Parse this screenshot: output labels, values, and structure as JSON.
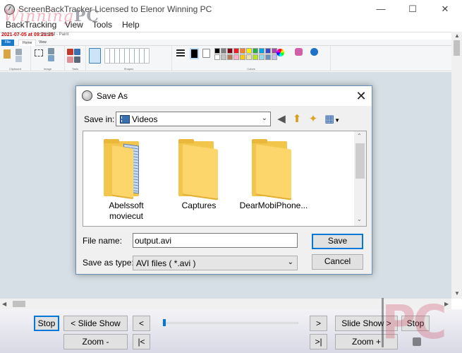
{
  "window": {
    "title": "ScreenBackTracker Licensed to Elenor Winning PC",
    "watermark_text": "Winning",
    "watermark_bold": "PC",
    "minimize": "—",
    "maximize": "☐",
    "close": "✕"
  },
  "menu": {
    "items": [
      "BackTracking",
      "View",
      "Tools",
      "Help"
    ]
  },
  "capture": {
    "timestamp": "2021-07-05 at 09:21:25",
    "paint_title": "Untitled - Paint",
    "tabs": [
      "File",
      "Home",
      "View"
    ],
    "ribbon_groups": [
      "Clipboard",
      "Image",
      "Tools",
      "Shapes",
      "Colors"
    ],
    "ribbon_labels": {
      "paste": "Paste",
      "cut": "Cut",
      "copy": "Copy",
      "select": "Select",
      "crop": "Crop",
      "resize": "Resize",
      "rotate": "Rotate",
      "brushes": "Brushes",
      "outline": "Outline",
      "fill": "Fill",
      "size": "Size",
      "color1": "Color 1",
      "color2": "Color 2",
      "edit_colors": "Edit colors",
      "edit_paint3d": "Edit with Paint 3D",
      "product_alert": "Product alert"
    },
    "palette": [
      "#000000",
      "#7f7f7f",
      "#880015",
      "#ed1c24",
      "#ff7f27",
      "#fff200",
      "#22b14c",
      "#00a2e8",
      "#3f48cc",
      "#a349a4",
      "#ffffff",
      "#c3c3c3",
      "#b97a57",
      "#ffaec9",
      "#ffc90e",
      "#efe4b0",
      "#b5e61d",
      "#99d9ea",
      "#7092be",
      "#c8bfe7"
    ]
  },
  "dialog": {
    "title": "Save As",
    "close": "✕",
    "save_in_label": "Save in:",
    "save_in_value": "Videos",
    "back_icon": "◀",
    "up_icon": "⬆",
    "new_folder_icon": "✦",
    "view_icon": "▦",
    "folders": [
      {
        "name": "Abelssoft moviecut",
        "line1": "Abelssoft",
        "line2": "moviecut"
      },
      {
        "name": "Captures",
        "line1": "Captures",
        "line2": ""
      },
      {
        "name": "DearMobiPhone...",
        "line1": "DearMobiPhone...",
        "line2": ""
      }
    ],
    "file_name_label": "File name:",
    "file_name_value": "output.avi",
    "save_type_label": "Save as type:",
    "save_type_value": "AVI files ( *.avi )",
    "save_button": "Save",
    "cancel_button": "Cancel"
  },
  "controls": {
    "stop": "Stop",
    "slide_show_back": "< Slide Show",
    "prev": "<",
    "next": ">",
    "slide_show_fwd": "Slide Show >",
    "stop_right": "Stop",
    "zoom_out": "Zoom -",
    "first": "|<",
    "last": ">|",
    "zoom_in": "Zoom +",
    "logo": "PC"
  }
}
